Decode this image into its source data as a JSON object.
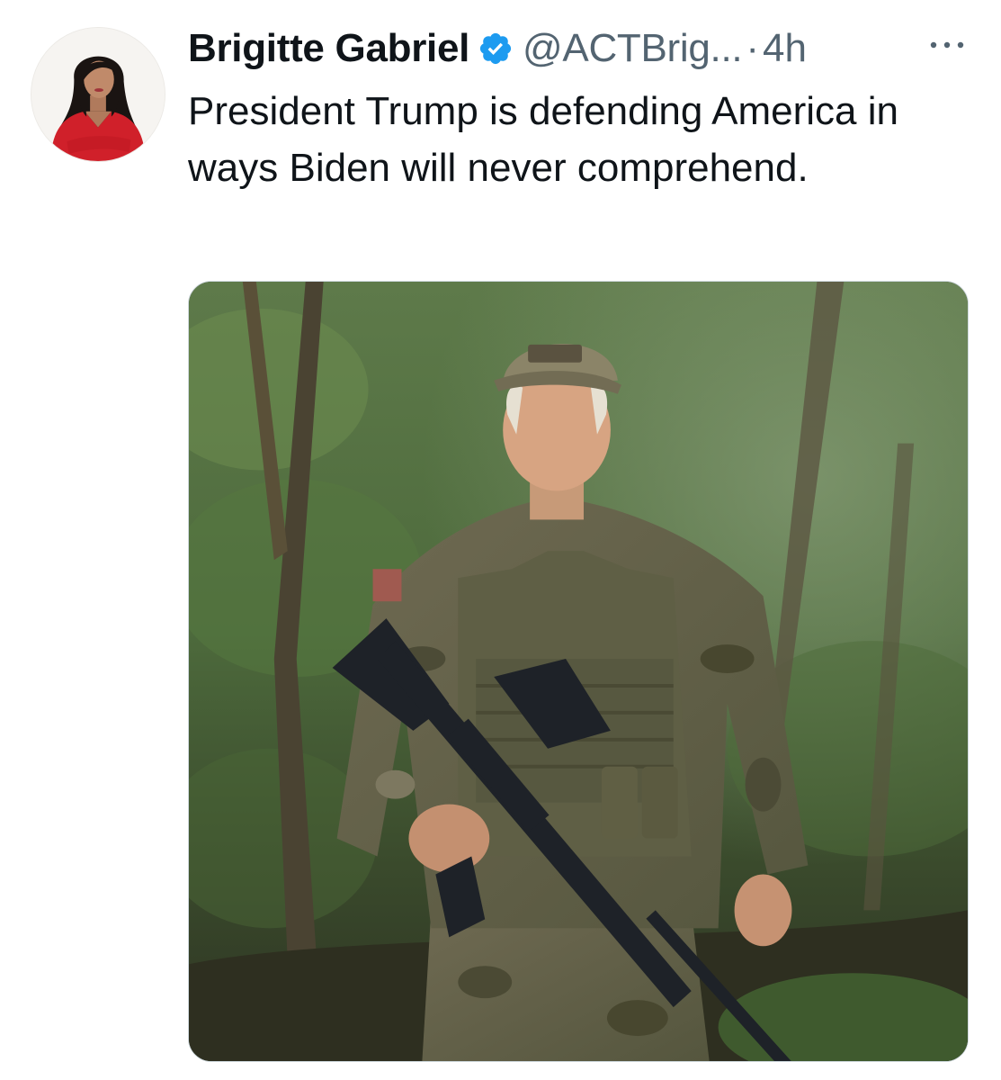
{
  "tweet": {
    "author": {
      "display_name": "Brigitte Gabriel",
      "handle": "@ACTBrig...",
      "verified": true,
      "avatar_icon": "profile-photo"
    },
    "separator": "·",
    "time": "4h",
    "more_icon": "ellipsis-icon",
    "text": "President Trump is defending America in ways Biden will never comprehend.",
    "media": {
      "type": "photo",
      "icon": "forest-soldier-photo"
    }
  },
  "colors": {
    "verified_blue": "#1d9bf0",
    "secondary_text": "#536471",
    "primary_text": "#0f1419",
    "background": "#ffffff"
  }
}
